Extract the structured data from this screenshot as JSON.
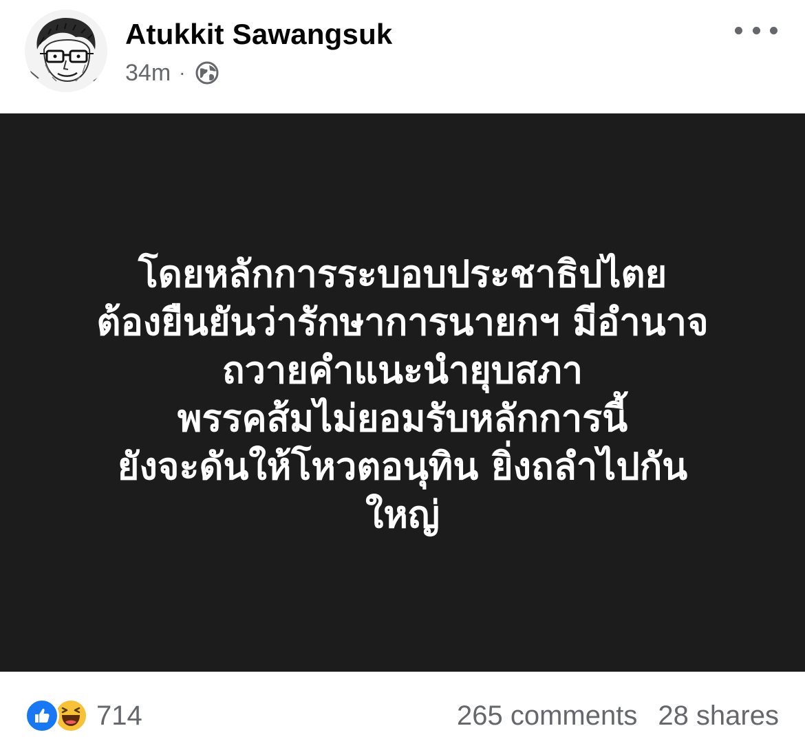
{
  "post": {
    "author": "Atukkit Sawangsuk",
    "time": "34m",
    "separator": "·",
    "audience_icon": "globe-icon",
    "more_icon": "more-options-icon"
  },
  "image_text": [
    "โดยหลักการระบอบประชาธิปไตย",
    "ต้องยืนยันว่ารักษาการนายกฯ มีอำนาจ",
    "ถวายคำแนะนำยุบสภา",
    "พรรคส้มไม่ยอมรับหลักการนี้",
    "ยังจะดันให้โหวตอนุทิน ยิ่งถลำไปกัน",
    "ใหญ่"
  ],
  "footer": {
    "reaction_icons": [
      "like-icon",
      "haha-icon"
    ],
    "reaction_count": "714",
    "comments": "265 comments",
    "shares": "28 shares"
  },
  "colors": {
    "image_background": "#1c1c1c",
    "like_blue": "#1877f2",
    "haha_yellow": "#f7c138",
    "meta_gray": "#65676b"
  }
}
